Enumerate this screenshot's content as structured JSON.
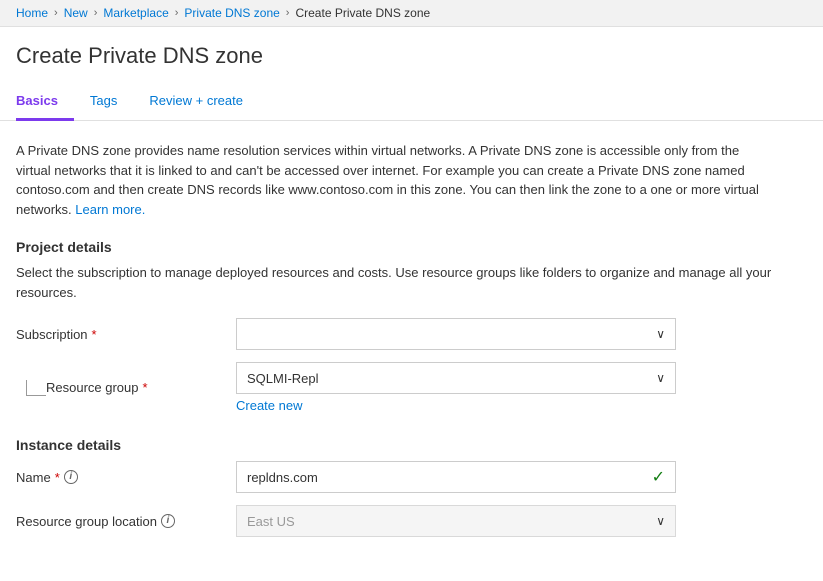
{
  "breadcrumb": {
    "items": [
      {
        "label": "Home",
        "active": false
      },
      {
        "label": "New",
        "active": false
      },
      {
        "label": "Marketplace",
        "active": false
      },
      {
        "label": "Private DNS zone",
        "active": false
      },
      {
        "label": "Create Private DNS zone",
        "active": true
      }
    ],
    "separators": [
      ">",
      ">",
      ">",
      ">"
    ]
  },
  "page": {
    "title": "Create Private DNS zone"
  },
  "tabs": [
    {
      "label": "Basics",
      "active": true
    },
    {
      "label": "Tags",
      "active": false
    },
    {
      "label": "Review + create",
      "active": false
    }
  ],
  "description": {
    "text": "A Private DNS zone provides name resolution services within virtual networks. A Private DNS zone is accessible only from the virtual networks that it is linked to and can't be accessed over internet. For example you can create a Private DNS zone named contoso.com and then create DNS records like www.contoso.com in this zone. You can then link the zone to a one or more virtual networks.",
    "link_text": "Learn more.",
    "link_url": "#"
  },
  "project_details": {
    "heading": "Project details",
    "sub_text": "Select the subscription to manage deployed resources and costs. Use resource groups like folders to organize and manage all your resources.",
    "subscription": {
      "label": "Subscription",
      "required": true,
      "value": "",
      "placeholder": ""
    },
    "resource_group": {
      "label": "Resource group",
      "required": true,
      "value": "SQLMI-Repl",
      "create_new_label": "Create new"
    }
  },
  "instance_details": {
    "heading": "Instance details",
    "name": {
      "label": "Name",
      "required": true,
      "has_info": true,
      "value": "repldns.com",
      "valid": true
    },
    "resource_group_location": {
      "label": "Resource group location",
      "has_info": true,
      "value": "East US",
      "disabled": true
    }
  },
  "icons": {
    "chevron_down": "∨",
    "check": "✓",
    "info": "i",
    "separator": "›"
  }
}
